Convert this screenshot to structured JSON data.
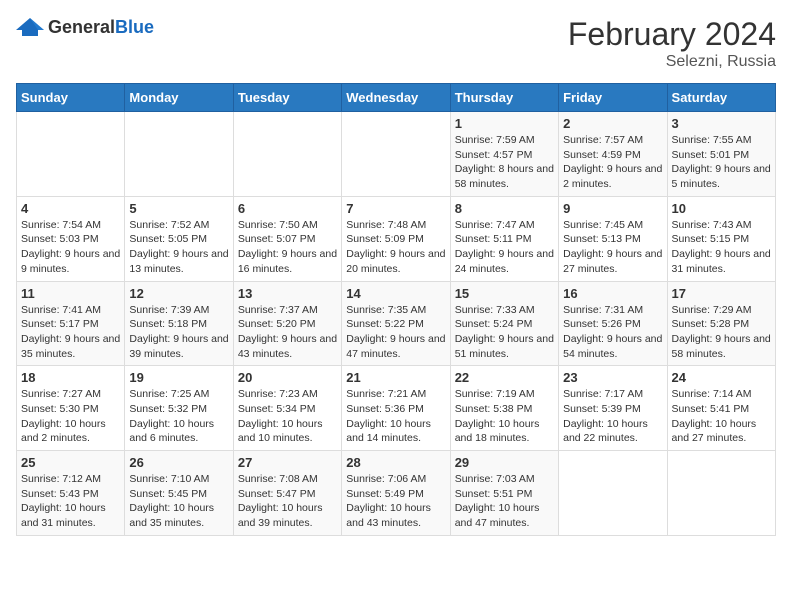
{
  "logo": {
    "general": "General",
    "blue": "Blue"
  },
  "title": "February 2024",
  "subtitle": "Selezni, Russia",
  "days_header": [
    "Sunday",
    "Monday",
    "Tuesday",
    "Wednesday",
    "Thursday",
    "Friday",
    "Saturday"
  ],
  "weeks": [
    [
      {
        "day": "",
        "sunrise": "",
        "sunset": "",
        "daylight": ""
      },
      {
        "day": "",
        "sunrise": "",
        "sunset": "",
        "daylight": ""
      },
      {
        "day": "",
        "sunrise": "",
        "sunset": "",
        "daylight": ""
      },
      {
        "day": "",
        "sunrise": "",
        "sunset": "",
        "daylight": ""
      },
      {
        "day": "1",
        "sunrise": "Sunrise: 7:59 AM",
        "sunset": "Sunset: 4:57 PM",
        "daylight": "Daylight: 8 hours and 58 minutes."
      },
      {
        "day": "2",
        "sunrise": "Sunrise: 7:57 AM",
        "sunset": "Sunset: 4:59 PM",
        "daylight": "Daylight: 9 hours and 2 minutes."
      },
      {
        "day": "3",
        "sunrise": "Sunrise: 7:55 AM",
        "sunset": "Sunset: 5:01 PM",
        "daylight": "Daylight: 9 hours and 5 minutes."
      }
    ],
    [
      {
        "day": "4",
        "sunrise": "Sunrise: 7:54 AM",
        "sunset": "Sunset: 5:03 PM",
        "daylight": "Daylight: 9 hours and 9 minutes."
      },
      {
        "day": "5",
        "sunrise": "Sunrise: 7:52 AM",
        "sunset": "Sunset: 5:05 PM",
        "daylight": "Daylight: 9 hours and 13 minutes."
      },
      {
        "day": "6",
        "sunrise": "Sunrise: 7:50 AM",
        "sunset": "Sunset: 5:07 PM",
        "daylight": "Daylight: 9 hours and 16 minutes."
      },
      {
        "day": "7",
        "sunrise": "Sunrise: 7:48 AM",
        "sunset": "Sunset: 5:09 PM",
        "daylight": "Daylight: 9 hours and 20 minutes."
      },
      {
        "day": "8",
        "sunrise": "Sunrise: 7:47 AM",
        "sunset": "Sunset: 5:11 PM",
        "daylight": "Daylight: 9 hours and 24 minutes."
      },
      {
        "day": "9",
        "sunrise": "Sunrise: 7:45 AM",
        "sunset": "Sunset: 5:13 PM",
        "daylight": "Daylight: 9 hours and 27 minutes."
      },
      {
        "day": "10",
        "sunrise": "Sunrise: 7:43 AM",
        "sunset": "Sunset: 5:15 PM",
        "daylight": "Daylight: 9 hours and 31 minutes."
      }
    ],
    [
      {
        "day": "11",
        "sunrise": "Sunrise: 7:41 AM",
        "sunset": "Sunset: 5:17 PM",
        "daylight": "Daylight: 9 hours and 35 minutes."
      },
      {
        "day": "12",
        "sunrise": "Sunrise: 7:39 AM",
        "sunset": "Sunset: 5:18 PM",
        "daylight": "Daylight: 9 hours and 39 minutes."
      },
      {
        "day": "13",
        "sunrise": "Sunrise: 7:37 AM",
        "sunset": "Sunset: 5:20 PM",
        "daylight": "Daylight: 9 hours and 43 minutes."
      },
      {
        "day": "14",
        "sunrise": "Sunrise: 7:35 AM",
        "sunset": "Sunset: 5:22 PM",
        "daylight": "Daylight: 9 hours and 47 minutes."
      },
      {
        "day": "15",
        "sunrise": "Sunrise: 7:33 AM",
        "sunset": "Sunset: 5:24 PM",
        "daylight": "Daylight: 9 hours and 51 minutes."
      },
      {
        "day": "16",
        "sunrise": "Sunrise: 7:31 AM",
        "sunset": "Sunset: 5:26 PM",
        "daylight": "Daylight: 9 hours and 54 minutes."
      },
      {
        "day": "17",
        "sunrise": "Sunrise: 7:29 AM",
        "sunset": "Sunset: 5:28 PM",
        "daylight": "Daylight: 9 hours and 58 minutes."
      }
    ],
    [
      {
        "day": "18",
        "sunrise": "Sunrise: 7:27 AM",
        "sunset": "Sunset: 5:30 PM",
        "daylight": "Daylight: 10 hours and 2 minutes."
      },
      {
        "day": "19",
        "sunrise": "Sunrise: 7:25 AM",
        "sunset": "Sunset: 5:32 PM",
        "daylight": "Daylight: 10 hours and 6 minutes."
      },
      {
        "day": "20",
        "sunrise": "Sunrise: 7:23 AM",
        "sunset": "Sunset: 5:34 PM",
        "daylight": "Daylight: 10 hours and 10 minutes."
      },
      {
        "day": "21",
        "sunrise": "Sunrise: 7:21 AM",
        "sunset": "Sunset: 5:36 PM",
        "daylight": "Daylight: 10 hours and 14 minutes."
      },
      {
        "day": "22",
        "sunrise": "Sunrise: 7:19 AM",
        "sunset": "Sunset: 5:38 PM",
        "daylight": "Daylight: 10 hours and 18 minutes."
      },
      {
        "day": "23",
        "sunrise": "Sunrise: 7:17 AM",
        "sunset": "Sunset: 5:39 PM",
        "daylight": "Daylight: 10 hours and 22 minutes."
      },
      {
        "day": "24",
        "sunrise": "Sunrise: 7:14 AM",
        "sunset": "Sunset: 5:41 PM",
        "daylight": "Daylight: 10 hours and 27 minutes."
      }
    ],
    [
      {
        "day": "25",
        "sunrise": "Sunrise: 7:12 AM",
        "sunset": "Sunset: 5:43 PM",
        "daylight": "Daylight: 10 hours and 31 minutes."
      },
      {
        "day": "26",
        "sunrise": "Sunrise: 7:10 AM",
        "sunset": "Sunset: 5:45 PM",
        "daylight": "Daylight: 10 hours and 35 minutes."
      },
      {
        "day": "27",
        "sunrise": "Sunrise: 7:08 AM",
        "sunset": "Sunset: 5:47 PM",
        "daylight": "Daylight: 10 hours and 39 minutes."
      },
      {
        "day": "28",
        "sunrise": "Sunrise: 7:06 AM",
        "sunset": "Sunset: 5:49 PM",
        "daylight": "Daylight: 10 hours and 43 minutes."
      },
      {
        "day": "29",
        "sunrise": "Sunrise: 7:03 AM",
        "sunset": "Sunset: 5:51 PM",
        "daylight": "Daylight: 10 hours and 47 minutes."
      },
      {
        "day": "",
        "sunrise": "",
        "sunset": "",
        "daylight": ""
      },
      {
        "day": "",
        "sunrise": "",
        "sunset": "",
        "daylight": ""
      }
    ]
  ]
}
